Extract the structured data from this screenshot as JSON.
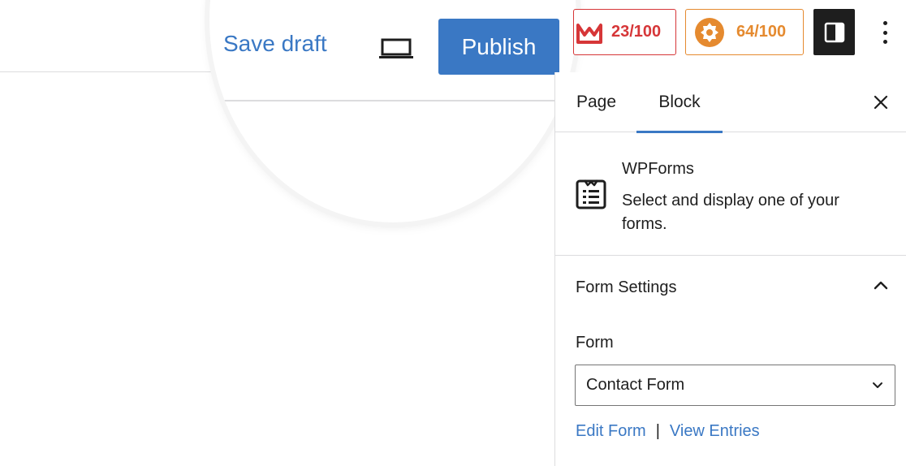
{
  "toolbar": {
    "save_draft_label": "Save draft",
    "preview_icon": "laptop-icon",
    "publish_label": "Publish",
    "seo_score": {
      "value": "23/100",
      "icon": "yoast-icon",
      "color": "#d63638"
    },
    "readability_score": {
      "value": "64/100",
      "icon": "readability-gear-icon",
      "color": "#e58a2f"
    },
    "settings_icon": "sidebar-toggle-icon",
    "more_icon": "vertical-ellipsis-icon"
  },
  "sidebar": {
    "tabs": [
      {
        "label": "Page",
        "active": false
      },
      {
        "label": "Block",
        "active": true
      }
    ],
    "close_icon": "close-icon",
    "block": {
      "icon": "wpforms-icon",
      "title": "WPForms",
      "description": "Select and display one of your forms."
    },
    "panel": {
      "title": "Form Settings",
      "toggle_icon": "chevron-up-icon",
      "form_label": "Form",
      "form_value": "Contact Form",
      "select_icon": "chevron-down-icon",
      "edit_link": "Edit Form",
      "separator": "|",
      "view_link": "View Entries"
    }
  },
  "colors": {
    "accent": "#3a78c4",
    "dark": "#1e1e1e",
    "border": "#dcdcde"
  }
}
